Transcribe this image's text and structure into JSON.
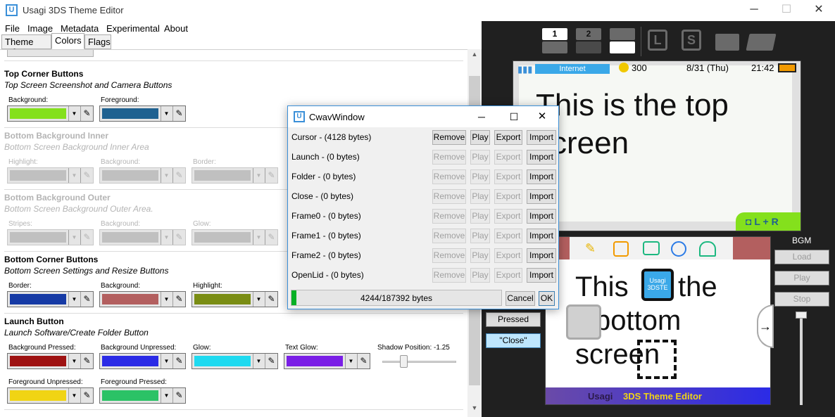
{
  "window": {
    "title": "Usagi 3DS Theme Editor",
    "icon_letter": "U",
    "minimize": "─",
    "maximize": "☐",
    "close": "✕"
  },
  "menu": [
    "File",
    "Image",
    "Metadata",
    "Experimental",
    "About"
  ],
  "tabs": [
    "Theme Info",
    "Colors",
    "Flags"
  ],
  "active_tab": "Colors",
  "sections": {
    "top_corner": {
      "title": "Top Corner Buttons",
      "subtitle": "Top Screen Screenshot and Camera Buttons",
      "fields": [
        {
          "label": "Background:",
          "color": "#84e01c"
        },
        {
          "label": "Foreground:",
          "color": "#1f6190"
        }
      ]
    },
    "bottom_bg_inner": {
      "title": "Bottom Background Inner",
      "subtitle": "Bottom Screen Background Inner Area",
      "fields": [
        {
          "label": "Highlight:",
          "color": "#c0c0c0"
        },
        {
          "label": "Background:",
          "color": "#c0c0c0"
        },
        {
          "label": "Border:",
          "color": "#c0c0c0"
        }
      ]
    },
    "bottom_bg_outer": {
      "title": "Bottom Background Outer",
      "subtitle": "Bottom Screen Background Outer Area.",
      "fields": [
        {
          "label": "Stripes:",
          "color": "#c0c0c0"
        },
        {
          "label": "Background:",
          "color": "#c0c0c0"
        },
        {
          "label": "Glow:",
          "color": "#c0c0c0"
        }
      ]
    },
    "bottom_corner": {
      "title": "Bottom Corner Buttons",
      "subtitle": "Bottom Screen Settings and Resize Buttons",
      "fields": [
        {
          "label": "Border:",
          "color": "#163aa5"
        },
        {
          "label": "Background:",
          "color": "#b35f5f"
        },
        {
          "label": "Highlight:",
          "color": "#7a8d14"
        }
      ]
    },
    "launch": {
      "title": "Launch Button",
      "subtitle": "Launch Software/Create Folder Button",
      "fields": [
        {
          "label": "Background Pressed:",
          "color": "#9e1212"
        },
        {
          "label": "Background Unpressed:",
          "color": "#2b2be6"
        },
        {
          "label": "Glow:",
          "color": "#1fdaf0"
        },
        {
          "label": "Text Glow:",
          "color": "#7a1fe6"
        }
      ],
      "fields2": [
        {
          "label": "Foreground Unpressed:",
          "color": "#f0d414"
        },
        {
          "label": "Foreground Pressed:",
          "color": "#2bc266"
        }
      ],
      "shadow_label": "Shadow Position: -1.25"
    }
  },
  "cwav": {
    "title": "CwavWindow",
    "icon_letter": "U",
    "rows": [
      {
        "label": "Cursor - (4128 bytes)",
        "enabled": true
      },
      {
        "label": "Launch - (0 bytes)",
        "enabled": false
      },
      {
        "label": "Folder - (0 bytes)",
        "enabled": false
      },
      {
        "label": "Close - (0 bytes)",
        "enabled": false
      },
      {
        "label": "Frame0 - (0 bytes)",
        "enabled": false
      },
      {
        "label": "Frame1 - (0 bytes)",
        "enabled": false
      },
      {
        "label": "Frame2 - (0 bytes)",
        "enabled": false
      },
      {
        "label": "OpenLid - (0 bytes)",
        "enabled": false
      }
    ],
    "btn_remove": "Remove",
    "btn_play": "Play",
    "btn_export": "Export",
    "btn_import": "Import",
    "progress_text": "4244/187392 bytes",
    "progress_fraction": 0.0226,
    "cancel": "Cancel",
    "ok": "OK",
    "minimize": "─",
    "maximize": "☐",
    "close": "✕"
  },
  "preview": {
    "top_btn_1": "1",
    "top_btn_2": "2",
    "btn_l": "L",
    "btn_s": "S",
    "status_internet": "Internet",
    "status_coins": "300",
    "status_date": "8/31 (Thu)",
    "status_time": "21:42",
    "top_text": "This is the top screen",
    "bottom_text_1": "This",
    "bottom_text_2": "the",
    "bottom_text_3": "bottom",
    "bottom_text_4": "screen",
    "app_icon_line1": "Usagi",
    "app_icon_line2": "3DSTE",
    "footer_left": "Usagi",
    "footer_right": "3DS Theme Editor",
    "bgm_label": "BGM",
    "bgm_load": "Load",
    "bgm_play": "Play",
    "bgm_stop": "Stop",
    "pressed": "Pressed",
    "close_quote": "\"Close\""
  }
}
